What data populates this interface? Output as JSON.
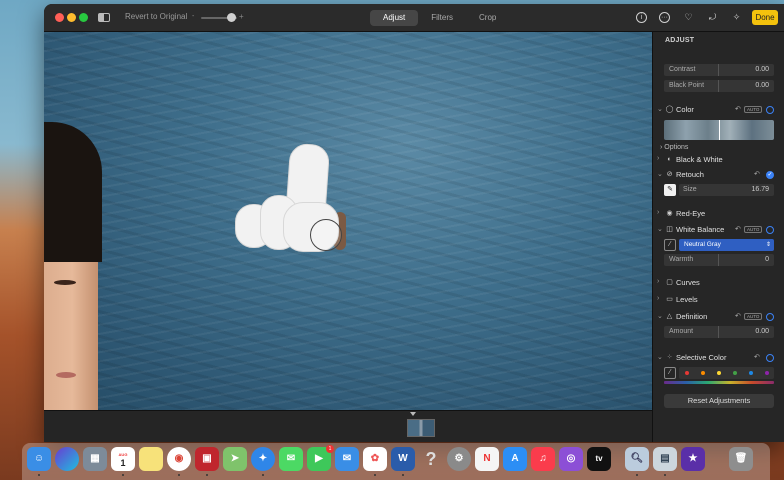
{
  "toolbar": {
    "revert_label": "Revert to Original",
    "zoom_min": "-",
    "zoom_max": "+",
    "tabs": [
      {
        "label": "Adjust",
        "active": true
      },
      {
        "label": "Filters",
        "active": false
      },
      {
        "label": "Crop",
        "active": false
      }
    ],
    "icons": [
      "info-icon",
      "more-icon",
      "heart-icon",
      "rotate-icon",
      "magic-wand-icon"
    ],
    "done_label": "Done",
    "accent_color": "#f4c20d"
  },
  "panel": {
    "title": "ADJUST",
    "contrast_label": "Contrast",
    "contrast_value": "0.00",
    "black_point_label": "Black Point",
    "black_point_value": "0.00",
    "color_label": "Color",
    "options_label": "Options",
    "bw_label": "Black & White",
    "retouch_label": "Retouch",
    "size_label": "Size",
    "size_value": "16.79",
    "red_eye_label": "Red-Eye",
    "wb_label": "White Balance",
    "wb_select": "Neutral Gray",
    "warmth_label": "Warmth",
    "warmth_value": "0",
    "curves_label": "Curves",
    "levels_label": "Levels",
    "definition_label": "Definition",
    "amount_label": "Amount",
    "amount_value": "0.00",
    "selective_label": "Selective Color",
    "reset_label": "Reset Adjustments",
    "auto_label": "AUTO"
  },
  "dock": {
    "calendar_month": "AUG",
    "calendar_day": "1",
    "facetime_badge": "1",
    "help_glyph": "?",
    "tv_label": "tv",
    "items": [
      "finder",
      "siri",
      "launchpad",
      "calendar",
      "notes",
      "chrome",
      "photo-booth",
      "maps",
      "safari",
      "messages",
      "facetime",
      "mail",
      "photos",
      "word",
      "help",
      "system-preferences",
      "news",
      "app-store",
      "music",
      "podcasts",
      "tv",
      "preview",
      "photos-2",
      "imovie",
      "trash"
    ]
  }
}
